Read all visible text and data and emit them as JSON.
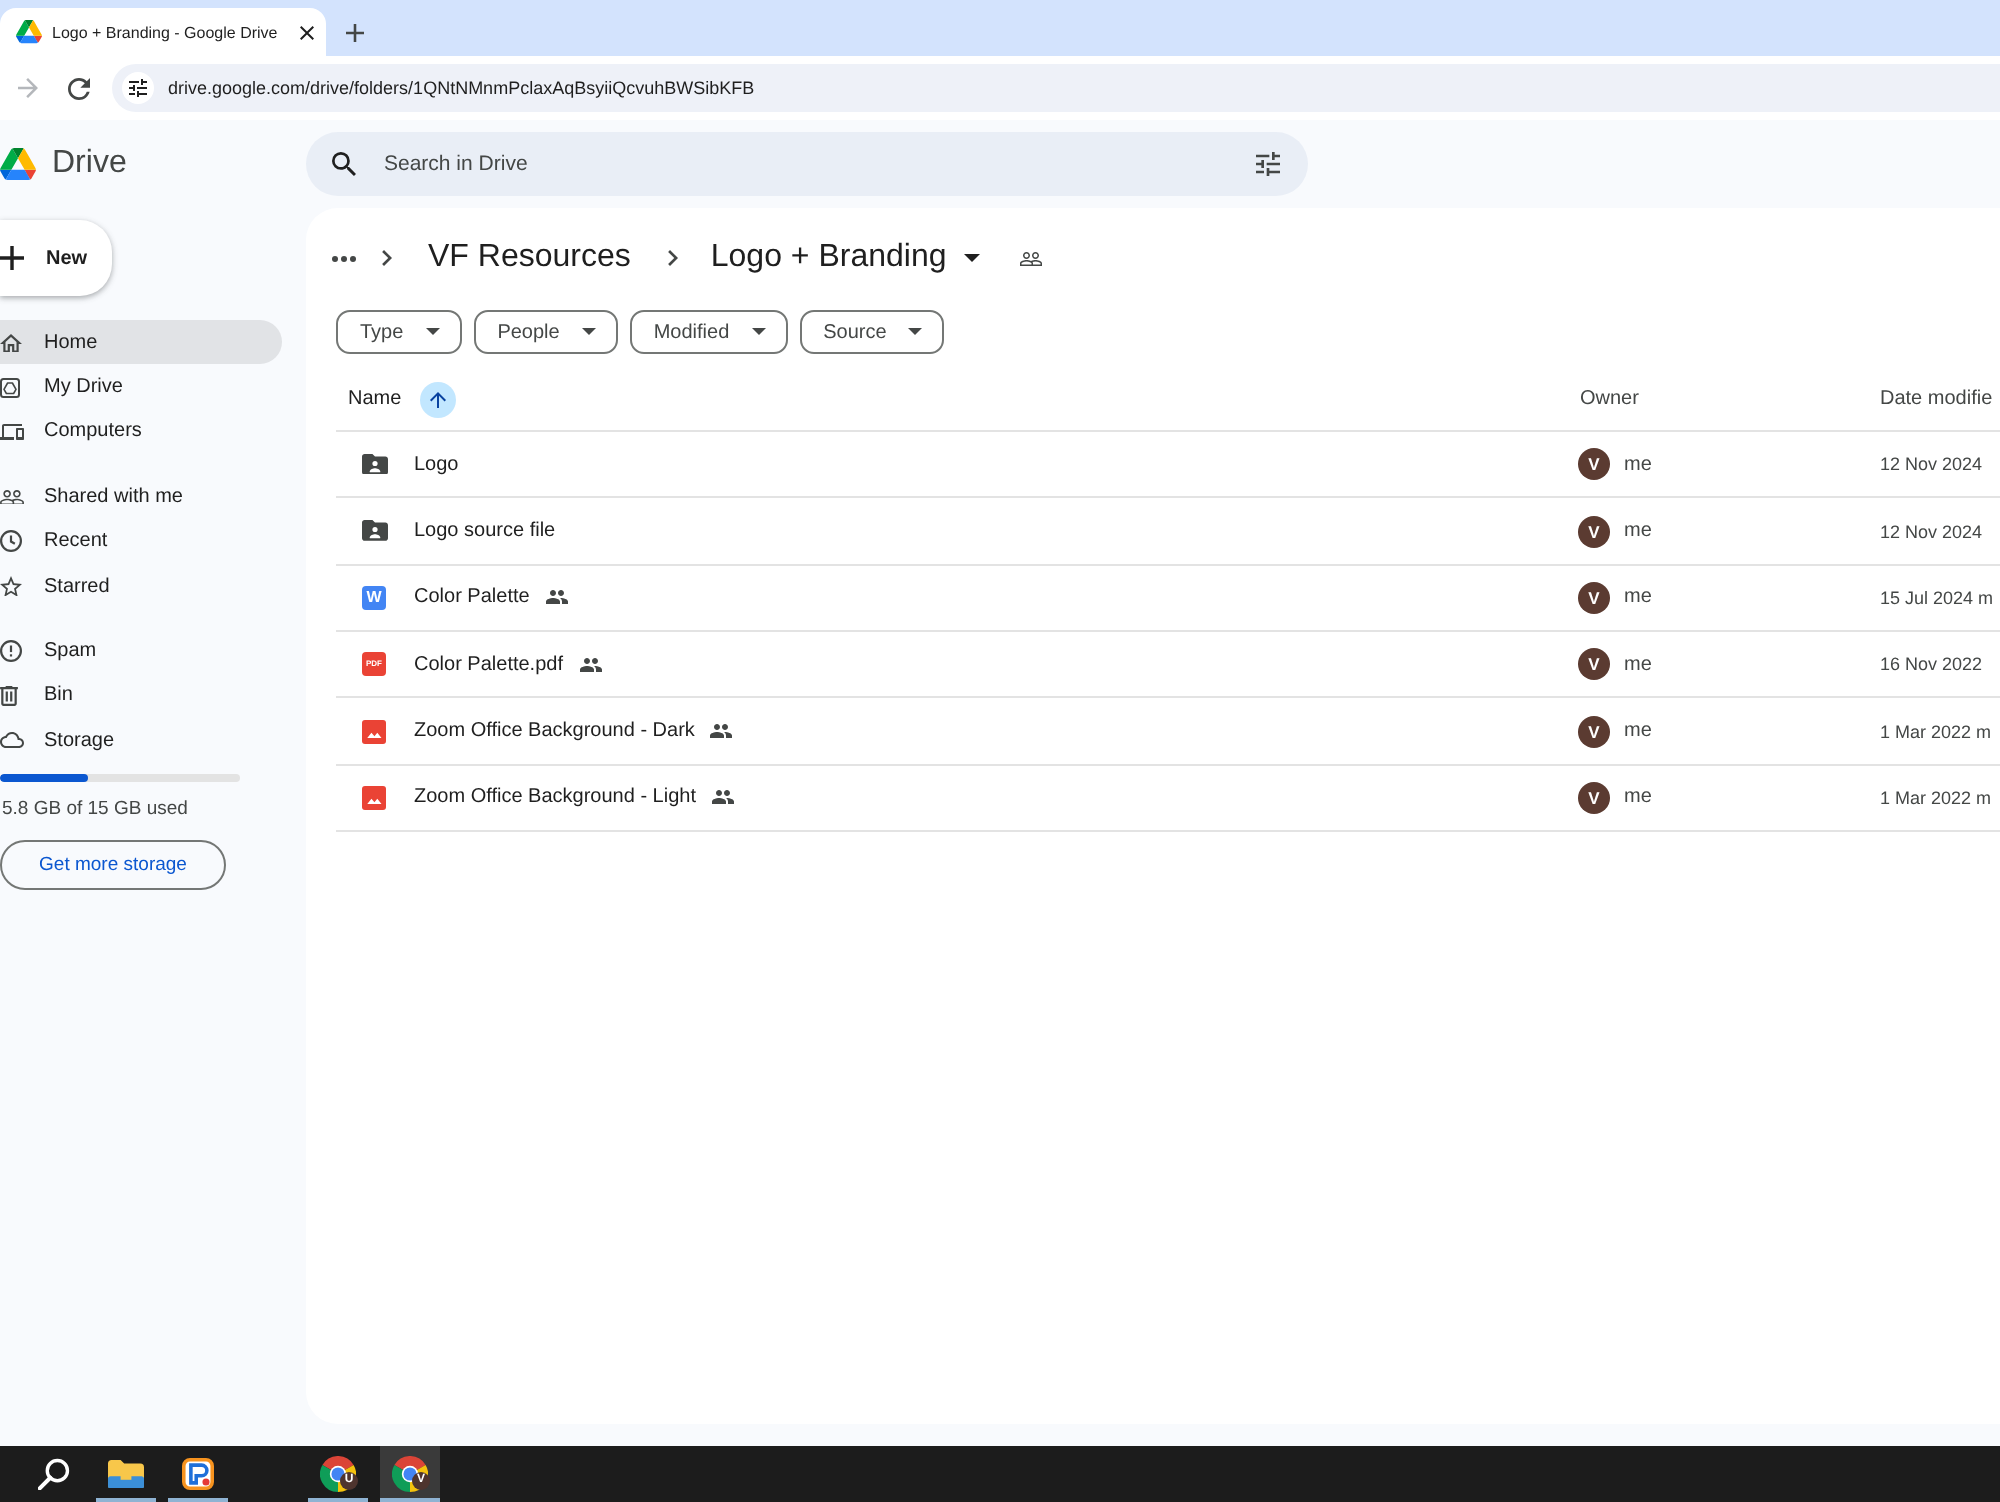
{
  "browser": {
    "tabs": [
      {
        "title": "Logo + Branding - Google Drive",
        "selected": true
      }
    ],
    "forward": {
      "disabled": true
    },
    "address_bar": {
      "url": "drive.google.com/drive/folders/1QNtNMnmPclaxAqBsyiiQcvuhBWSibKFB"
    }
  },
  "app": {
    "name": "Drive"
  },
  "search": {
    "placeholder": "Search in Drive"
  },
  "sidebar": {
    "new_button": "New",
    "groups": [
      {
        "items": [
          {
            "label": "Home",
            "selected": true
          },
          {
            "label": "My Drive",
            "selected": false
          },
          {
            "label": "Computers",
            "selected": false
          }
        ]
      },
      {
        "items": [
          {
            "label": "Shared with me",
            "selected": false
          },
          {
            "label": "Recent",
            "selected": false
          },
          {
            "label": "Starred",
            "selected": false
          }
        ]
      },
      {
        "items": [
          {
            "label": "Spam",
            "selected": false
          },
          {
            "label": "Bin",
            "selected": false
          },
          {
            "label": "Storage",
            "selected": false
          }
        ]
      }
    ],
    "storage": {
      "level": 0.37,
      "usage": "5.8 GB of 15 GB used",
      "button": "Get more storage"
    }
  },
  "breadcrumb": [
    {
      "label": "VF Resources",
      "current": false,
      "shared": false
    },
    {
      "label": "Logo + Branding",
      "current": true,
      "shared": true
    }
  ],
  "filters": [
    {
      "label": "Type"
    },
    {
      "label": "People"
    },
    {
      "label": "Modified"
    },
    {
      "label": "Source"
    }
  ],
  "table": {
    "columns": [
      {
        "label": "Name",
        "sorted": true
      },
      {
        "label": "Owner",
        "sorted": false
      },
      {
        "label": "Date modifie",
        "sorted": false
      }
    ],
    "rows": [
      {
        "kind": "folder",
        "name": "Logo",
        "shared": false,
        "owner_initial": "V",
        "owner": "me",
        "modified": "12 Nov 2024"
      },
      {
        "kind": "folder",
        "name": "Logo source file",
        "shared": false,
        "owner_initial": "V",
        "owner": "me",
        "modified": "12 Nov 2024"
      },
      {
        "kind": "doc",
        "icon_label": "W",
        "name": "Color Palette",
        "shared": true,
        "owner_initial": "V",
        "owner": "me",
        "modified": "15 Jul 2024 m"
      },
      {
        "kind": "pdf",
        "icon_label": "PDF",
        "name": "Color Palette.pdf",
        "shared": true,
        "owner_initial": "V",
        "owner": "me",
        "modified": "16 Nov 2022"
      },
      {
        "kind": "image",
        "name": "Zoom Office Background - Dark",
        "shared": true,
        "owner_initial": "V",
        "owner": "me",
        "modified": "1 Mar 2022 m"
      },
      {
        "kind": "image",
        "name": "Zoom Office Background - Light",
        "shared": true,
        "owner_initial": "V",
        "owner": "me",
        "modified": "1 Mar 2022 m"
      }
    ]
  },
  "taskbar": {
    "items": [
      {
        "kind": "search"
      },
      {
        "kind": "files"
      },
      {
        "kind": "app"
      },
      {
        "kind": "browser",
        "badge": "U",
        "selected": false
      },
      {
        "kind": "browser",
        "badge": "V",
        "selected": true
      }
    ]
  }
}
